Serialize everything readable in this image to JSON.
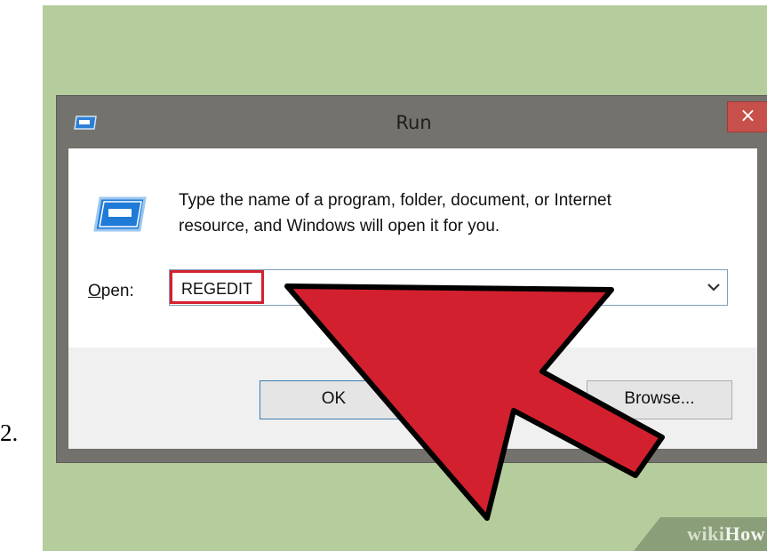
{
  "step_number": "2.",
  "dialog": {
    "title": "Run",
    "close_glyph": "×",
    "description_line1": "Type the name of a program, folder, document, or Internet",
    "description_line2": "resource, and Windows will open it for you.",
    "open_label_accel": "O",
    "open_label_rest": "pen:",
    "open_value": "REGEDIT",
    "ok_label": "OK",
    "browse_label": "Browse...",
    "icons": [
      "run-app-icon",
      "close-icon",
      "chevron-down-icon"
    ]
  },
  "annotation": {
    "arrow_color": "#d3202f",
    "highlight_color": "#d3202f"
  },
  "watermark": {
    "wiki": "wiki",
    "how": "How"
  }
}
